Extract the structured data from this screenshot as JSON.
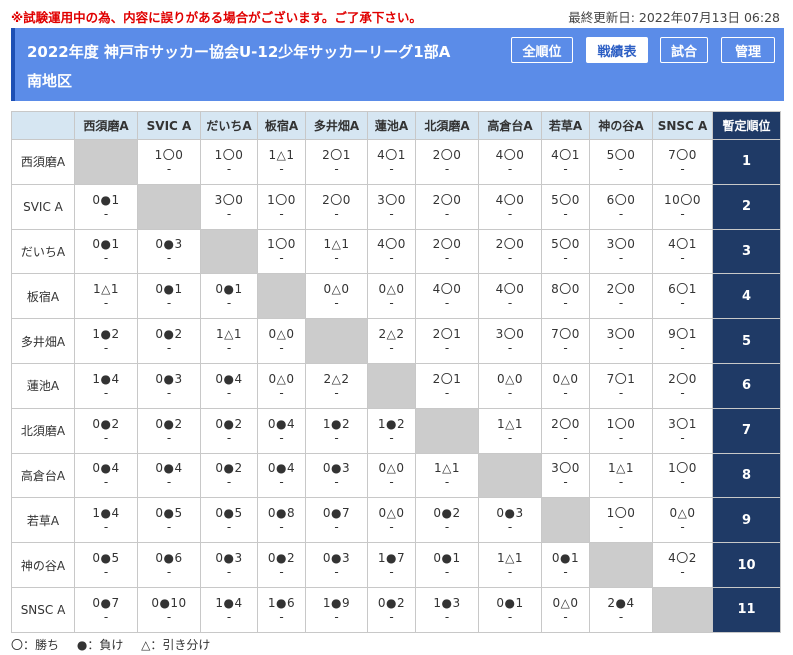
{
  "notice": "※試験運用中の為、内容に誤りがある場合がございます。ご了承下さい。",
  "updated": "最終更新日: 2022年07月13日 06:28",
  "title_line1": "2022年度 神戸市サッカー協会U-12少年サッカーリーグ1部A",
  "title_line2": "南地区",
  "nav": {
    "overall": "全順位",
    "results": "戦績表",
    "matches": "試合",
    "admin": "管理"
  },
  "rank_header": "暫定順位",
  "teams": [
    "西須磨A",
    "SVIC A",
    "だいちA",
    "板宿A",
    "多井畑A",
    "蓮池A",
    "北須磨A",
    "高倉台A",
    "若草A",
    "神の谷A",
    "SNSC A"
  ],
  "rows": [
    {
      "team": "西須磨A",
      "rank": "1",
      "cells": [
        "",
        "1〇0",
        "1〇0",
        "1△1",
        "2〇1",
        "4〇1",
        "2〇0",
        "4〇0",
        "4〇1",
        "5〇0",
        "7〇0"
      ]
    },
    {
      "team": "SVIC A",
      "rank": "2",
      "cells": [
        "0●1",
        "",
        "3〇0",
        "1〇0",
        "2〇0",
        "3〇0",
        "2〇0",
        "4〇0",
        "5〇0",
        "6〇0",
        "10〇0"
      ]
    },
    {
      "team": "だいちA",
      "rank": "3",
      "cells": [
        "0●1",
        "0●3",
        "",
        "1〇0",
        "1△1",
        "4〇0",
        "2〇0",
        "2〇0",
        "5〇0",
        "3〇0",
        "4〇1"
      ]
    },
    {
      "team": "板宿A",
      "rank": "4",
      "cells": [
        "1△1",
        "0●1",
        "0●1",
        "",
        "0△0",
        "0△0",
        "4〇0",
        "4〇0",
        "8〇0",
        "2〇0",
        "6〇1"
      ]
    },
    {
      "team": "多井畑A",
      "rank": "5",
      "cells": [
        "1●2",
        "0●2",
        "1△1",
        "0△0",
        "",
        "2△2",
        "2〇1",
        "3〇0",
        "7〇0",
        "3〇0",
        "9〇1"
      ]
    },
    {
      "team": "蓮池A",
      "rank": "6",
      "cells": [
        "1●4",
        "0●3",
        "0●4",
        "0△0",
        "2△2",
        "",
        "2〇1",
        "0△0",
        "0△0",
        "7〇1",
        "2〇0"
      ]
    },
    {
      "team": "北須磨A",
      "rank": "7",
      "cells": [
        "0●2",
        "0●2",
        "0●2",
        "0●4",
        "1●2",
        "1●2",
        "",
        "1△1",
        "2〇0",
        "1〇0",
        "3〇1"
      ]
    },
    {
      "team": "高倉台A",
      "rank": "8",
      "cells": [
        "0●4",
        "0●4",
        "0●2",
        "0●4",
        "0●3",
        "0△0",
        "1△1",
        "",
        "3〇0",
        "1△1",
        "1〇0"
      ]
    },
    {
      "team": "若草A",
      "rank": "9",
      "cells": [
        "1●4",
        "0●5",
        "0●5",
        "0●8",
        "0●7",
        "0△0",
        "0●2",
        "0●3",
        "",
        "1〇0",
        "0△0"
      ]
    },
    {
      "team": "神の谷A",
      "rank": "10",
      "cells": [
        "0●5",
        "0●6",
        "0●3",
        "0●2",
        "0●3",
        "1●7",
        "0●1",
        "1△1",
        "0●1",
        "",
        "4〇2"
      ]
    },
    {
      "team": "SNSC A",
      "rank": "11",
      "cells": [
        "0●7",
        "0●10",
        "1●4",
        "1●6",
        "1●9",
        "0●2",
        "1●3",
        "0●1",
        "0△0",
        "2●4",
        ""
      ]
    }
  ],
  "cell_sub": "-",
  "legend": {
    "win": "〇：勝ち",
    "loss": "●：負け",
    "draw": "△：引き分け"
  }
}
